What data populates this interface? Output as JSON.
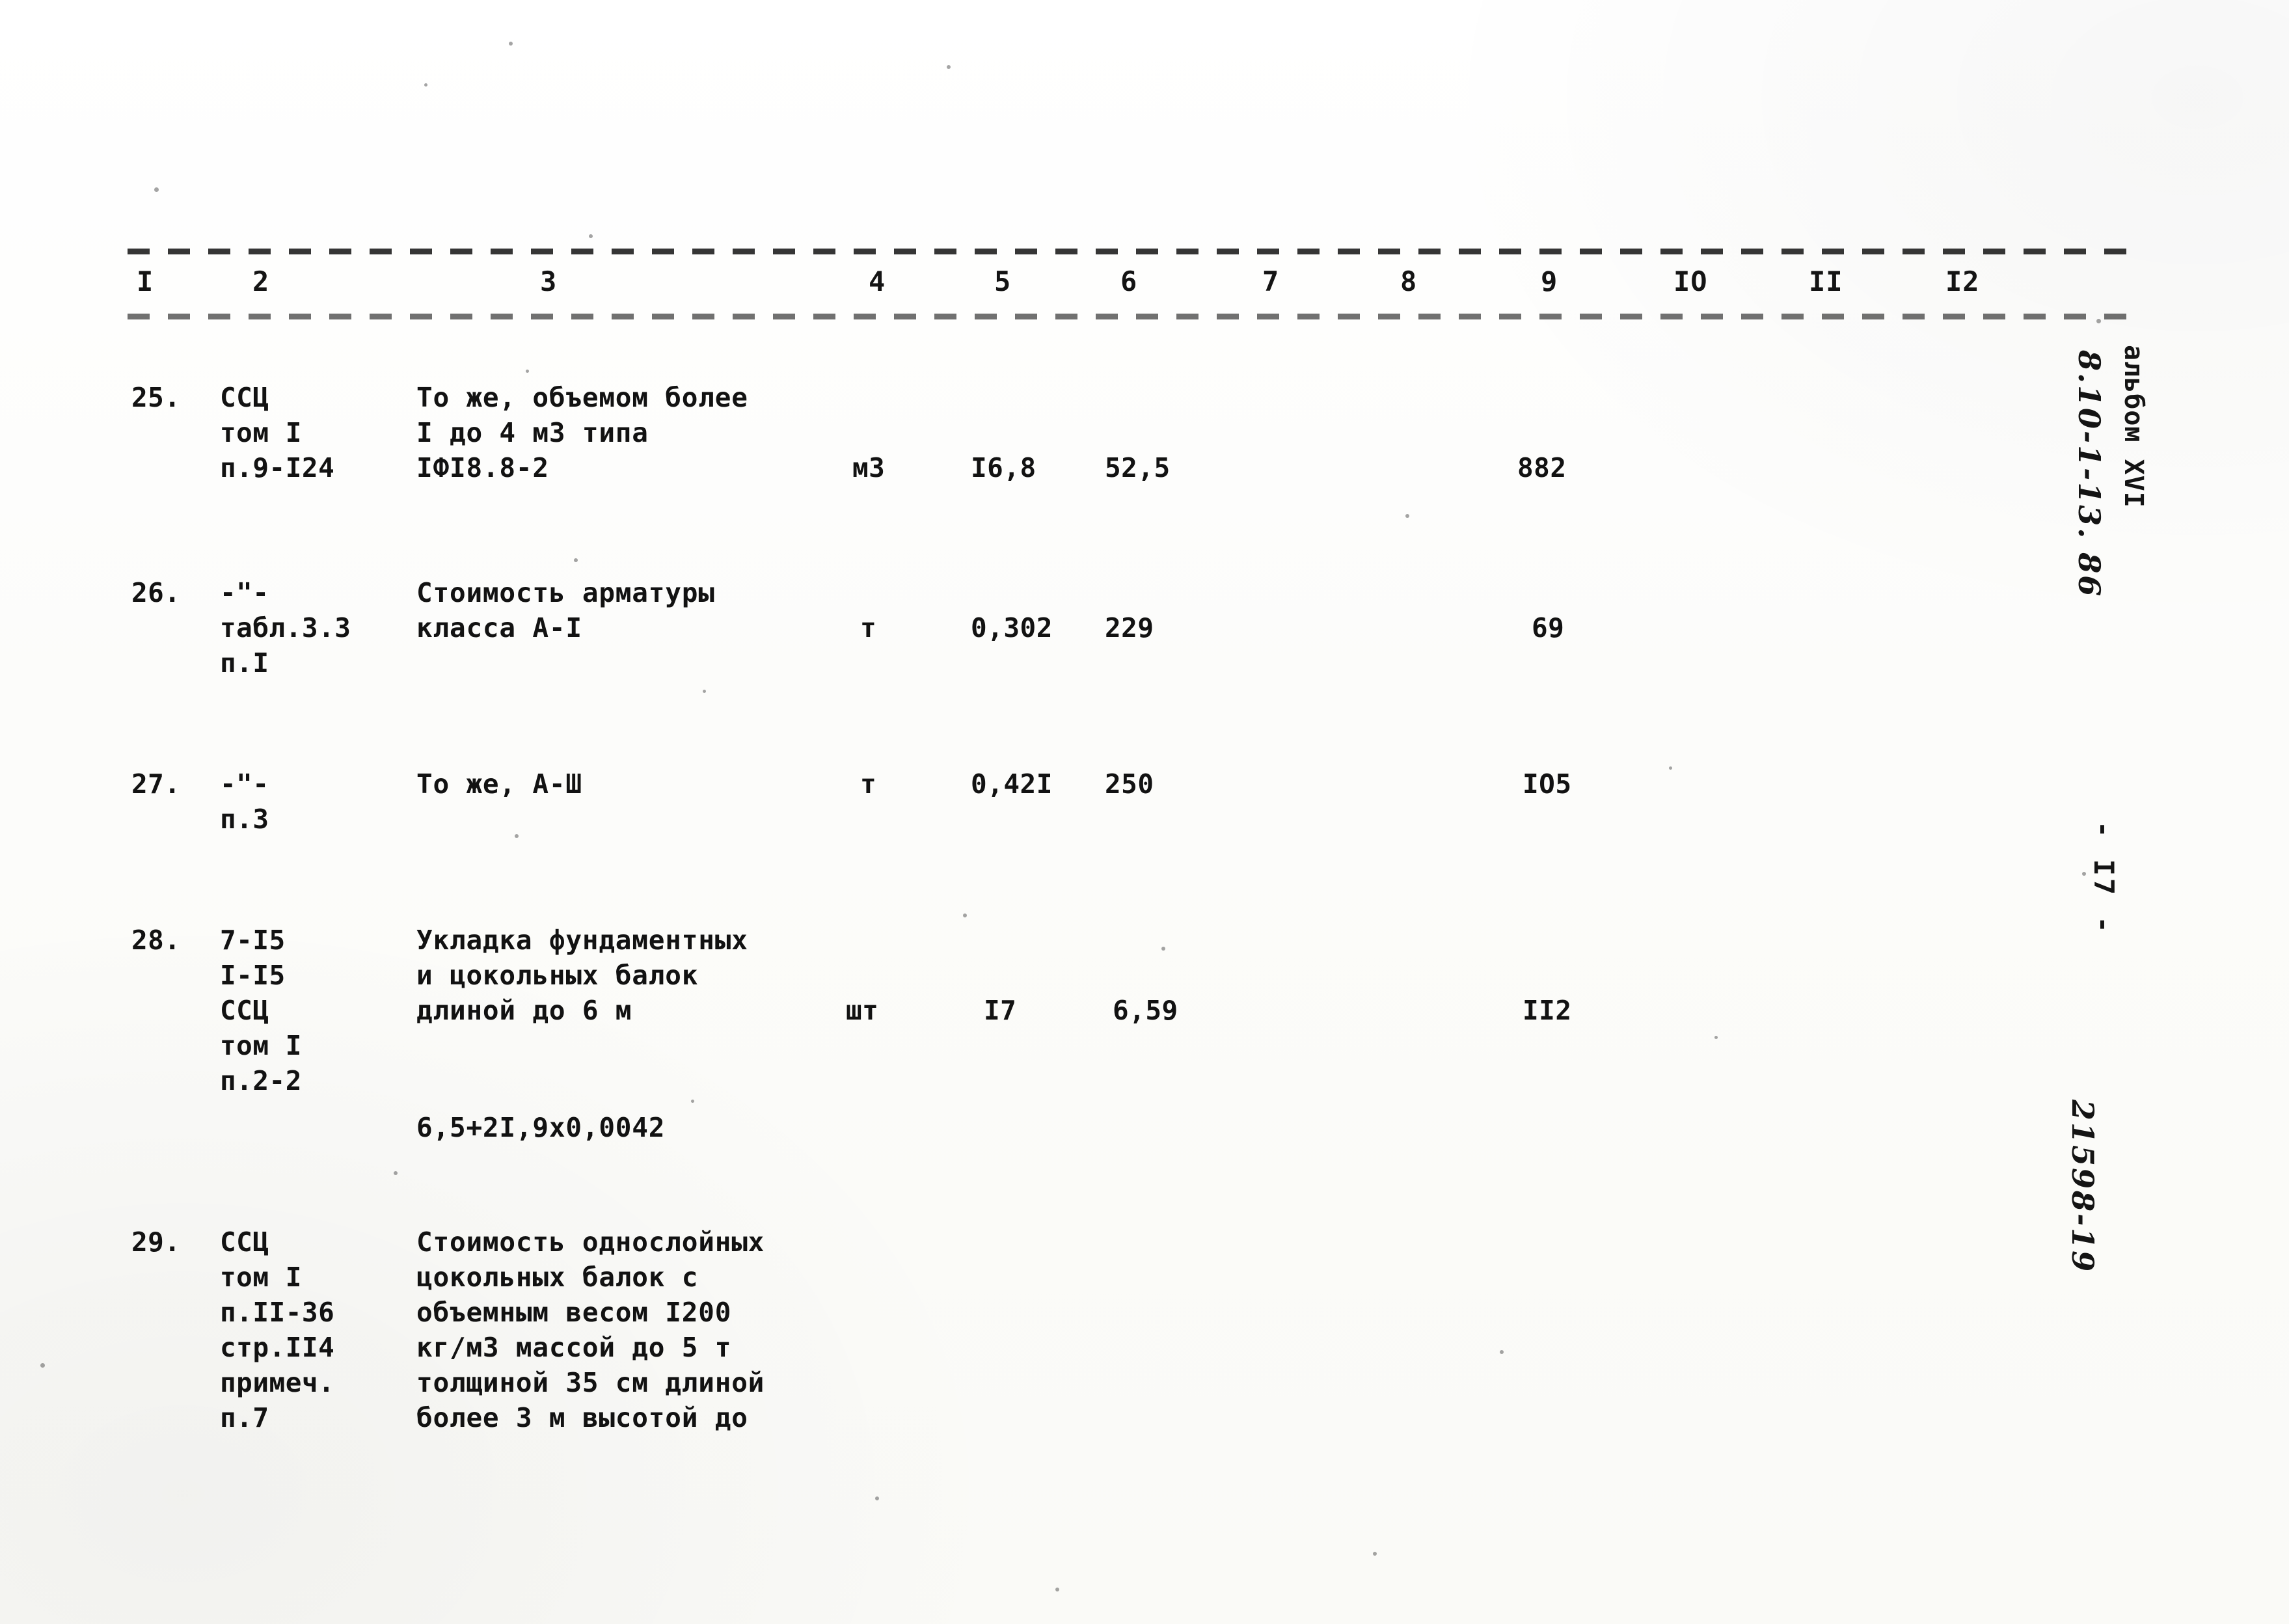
{
  "document": {
    "type": "scanned-estimate-table",
    "language": "ru",
    "album_label": "альбом XVI",
    "album_code_handwritten": "8.10-1-13. 86",
    "page_number_label": "- I7 -",
    "archive_number_handwritten": "21598-19"
  },
  "table": {
    "column_numbers": [
      "I",
      "2",
      "3",
      "4",
      "5",
      "6",
      "7",
      "8",
      "9",
      "IO",
      "II",
      "I2"
    ],
    "rows": [
      {
        "no": "25.",
        "code_lines": [
          "ССЦ",
          "том I",
          "п.9-I24"
        ],
        "desc_lines": [
          "То же, объемом более",
          "I до 4 м3 типа",
          "IФI8.8-2"
        ],
        "unit": "м3",
        "qty": "I6,8",
        "price": "52,5",
        "col7": "",
        "col8": "",
        "total": "882",
        "col10": "",
        "col11": "",
        "col12": ""
      },
      {
        "no": "26.",
        "code_lines": [
          "-\"-",
          "табл.3.3",
          "п.I"
        ],
        "desc_lines": [
          "Стоимость арматуры",
          "класса А-I"
        ],
        "unit": "т",
        "qty": "0,302",
        "price": "229",
        "col7": "",
        "col8": "",
        "total": "69",
        "col10": "",
        "col11": "",
        "col12": ""
      },
      {
        "no": "27.",
        "code_lines": [
          "-\"-",
          "п.3"
        ],
        "desc_lines": [
          "То же, А-Ш"
        ],
        "unit": "т",
        "qty": "0,42I",
        "price": "250",
        "col7": "",
        "col8": "",
        "total": "IO5",
        "col10": "",
        "col11": "",
        "col12": ""
      },
      {
        "no": "28.",
        "code_lines": [
          "7-I5",
          "I-I5",
          "ССЦ",
          "том I",
          "п.2-2"
        ],
        "desc_lines": [
          "Укладка фундаментных",
          "и цокольных балок",
          "длиной до 6 м"
        ],
        "formula": "6,5+2I,9х0,0042",
        "unit": "шт",
        "qty": "I7",
        "price": "6,59",
        "col7": "",
        "col8": "",
        "total": "II2",
        "col10": "",
        "col11": "",
        "col12": ""
      },
      {
        "no": "29.",
        "code_lines": [
          "ССЦ",
          "том I",
          "п.II-36",
          "стр.II4",
          "примеч.",
          "п.7"
        ],
        "desc_lines": [
          "Стоимость однослойных",
          "цокольных балок с",
          "объемным весом I200",
          "кг/м3 массой до 5 т",
          "толщиной 35 см длиной",
          "более 3 м высотой до"
        ],
        "unit": "",
        "qty": "",
        "price": "",
        "col7": "",
        "col8": "",
        "total": "",
        "col10": "",
        "col11": "",
        "col12": ""
      }
    ]
  }
}
